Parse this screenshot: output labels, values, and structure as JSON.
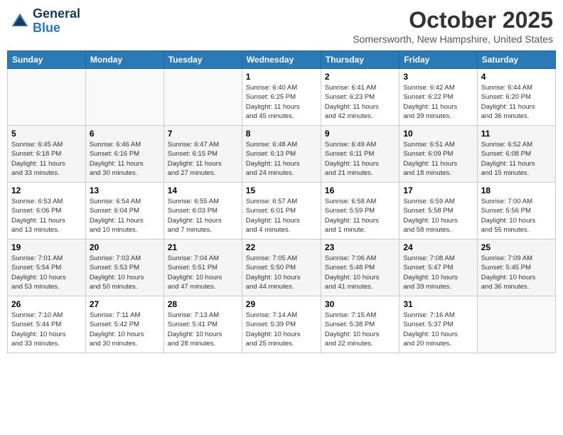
{
  "header": {
    "logo_line1": "General",
    "logo_line2": "Blue",
    "month": "October 2025",
    "location": "Somersworth, New Hampshire, United States"
  },
  "weekdays": [
    "Sunday",
    "Monday",
    "Tuesday",
    "Wednesday",
    "Thursday",
    "Friday",
    "Saturday"
  ],
  "weeks": [
    [
      {
        "day": "",
        "info": ""
      },
      {
        "day": "",
        "info": ""
      },
      {
        "day": "",
        "info": ""
      },
      {
        "day": "1",
        "info": "Sunrise: 6:40 AM\nSunset: 6:25 PM\nDaylight: 11 hours\nand 45 minutes."
      },
      {
        "day": "2",
        "info": "Sunrise: 6:41 AM\nSunset: 6:23 PM\nDaylight: 11 hours\nand 42 minutes."
      },
      {
        "day": "3",
        "info": "Sunrise: 6:42 AM\nSunset: 6:22 PM\nDaylight: 11 hours\nand 39 minutes."
      },
      {
        "day": "4",
        "info": "Sunrise: 6:44 AM\nSunset: 6:20 PM\nDaylight: 11 hours\nand 36 minutes."
      }
    ],
    [
      {
        "day": "5",
        "info": "Sunrise: 6:45 AM\nSunset: 6:18 PM\nDaylight: 11 hours\nand 33 minutes."
      },
      {
        "day": "6",
        "info": "Sunrise: 6:46 AM\nSunset: 6:16 PM\nDaylight: 11 hours\nand 30 minutes."
      },
      {
        "day": "7",
        "info": "Sunrise: 6:47 AM\nSunset: 6:15 PM\nDaylight: 11 hours\nand 27 minutes."
      },
      {
        "day": "8",
        "info": "Sunrise: 6:48 AM\nSunset: 6:13 PM\nDaylight: 11 hours\nand 24 minutes."
      },
      {
        "day": "9",
        "info": "Sunrise: 6:49 AM\nSunset: 6:11 PM\nDaylight: 11 hours\nand 21 minutes."
      },
      {
        "day": "10",
        "info": "Sunrise: 6:51 AM\nSunset: 6:09 PM\nDaylight: 11 hours\nand 18 minutes."
      },
      {
        "day": "11",
        "info": "Sunrise: 6:52 AM\nSunset: 6:08 PM\nDaylight: 11 hours\nand 15 minutes."
      }
    ],
    [
      {
        "day": "12",
        "info": "Sunrise: 6:53 AM\nSunset: 6:06 PM\nDaylight: 11 hours\nand 13 minutes."
      },
      {
        "day": "13",
        "info": "Sunrise: 6:54 AM\nSunset: 6:04 PM\nDaylight: 11 hours\nand 10 minutes."
      },
      {
        "day": "14",
        "info": "Sunrise: 6:55 AM\nSunset: 6:03 PM\nDaylight: 11 hours\nand 7 minutes."
      },
      {
        "day": "15",
        "info": "Sunrise: 6:57 AM\nSunset: 6:01 PM\nDaylight: 11 hours\nand 4 minutes."
      },
      {
        "day": "16",
        "info": "Sunrise: 6:58 AM\nSunset: 5:59 PM\nDaylight: 11 hours\nand 1 minute."
      },
      {
        "day": "17",
        "info": "Sunrise: 6:59 AM\nSunset: 5:58 PM\nDaylight: 10 hours\nand 58 minutes."
      },
      {
        "day": "18",
        "info": "Sunrise: 7:00 AM\nSunset: 5:56 PM\nDaylight: 10 hours\nand 55 minutes."
      }
    ],
    [
      {
        "day": "19",
        "info": "Sunrise: 7:01 AM\nSunset: 5:54 PM\nDaylight: 10 hours\nand 53 minutes."
      },
      {
        "day": "20",
        "info": "Sunrise: 7:03 AM\nSunset: 5:53 PM\nDaylight: 10 hours\nand 50 minutes."
      },
      {
        "day": "21",
        "info": "Sunrise: 7:04 AM\nSunset: 5:51 PM\nDaylight: 10 hours\nand 47 minutes."
      },
      {
        "day": "22",
        "info": "Sunrise: 7:05 AM\nSunset: 5:50 PM\nDaylight: 10 hours\nand 44 minutes."
      },
      {
        "day": "23",
        "info": "Sunrise: 7:06 AM\nSunset: 5:48 PM\nDaylight: 10 hours\nand 41 minutes."
      },
      {
        "day": "24",
        "info": "Sunrise: 7:08 AM\nSunset: 5:47 PM\nDaylight: 10 hours\nand 39 minutes."
      },
      {
        "day": "25",
        "info": "Sunrise: 7:09 AM\nSunset: 5:45 PM\nDaylight: 10 hours\nand 36 minutes."
      }
    ],
    [
      {
        "day": "26",
        "info": "Sunrise: 7:10 AM\nSunset: 5:44 PM\nDaylight: 10 hours\nand 33 minutes."
      },
      {
        "day": "27",
        "info": "Sunrise: 7:11 AM\nSunset: 5:42 PM\nDaylight: 10 hours\nand 30 minutes."
      },
      {
        "day": "28",
        "info": "Sunrise: 7:13 AM\nSunset: 5:41 PM\nDaylight: 10 hours\nand 28 minutes."
      },
      {
        "day": "29",
        "info": "Sunrise: 7:14 AM\nSunset: 5:39 PM\nDaylight: 10 hours\nand 25 minutes."
      },
      {
        "day": "30",
        "info": "Sunrise: 7:15 AM\nSunset: 5:38 PM\nDaylight: 10 hours\nand 22 minutes."
      },
      {
        "day": "31",
        "info": "Sunrise: 7:16 AM\nSunset: 5:37 PM\nDaylight: 10 hours\nand 20 minutes."
      },
      {
        "day": "",
        "info": ""
      }
    ]
  ]
}
